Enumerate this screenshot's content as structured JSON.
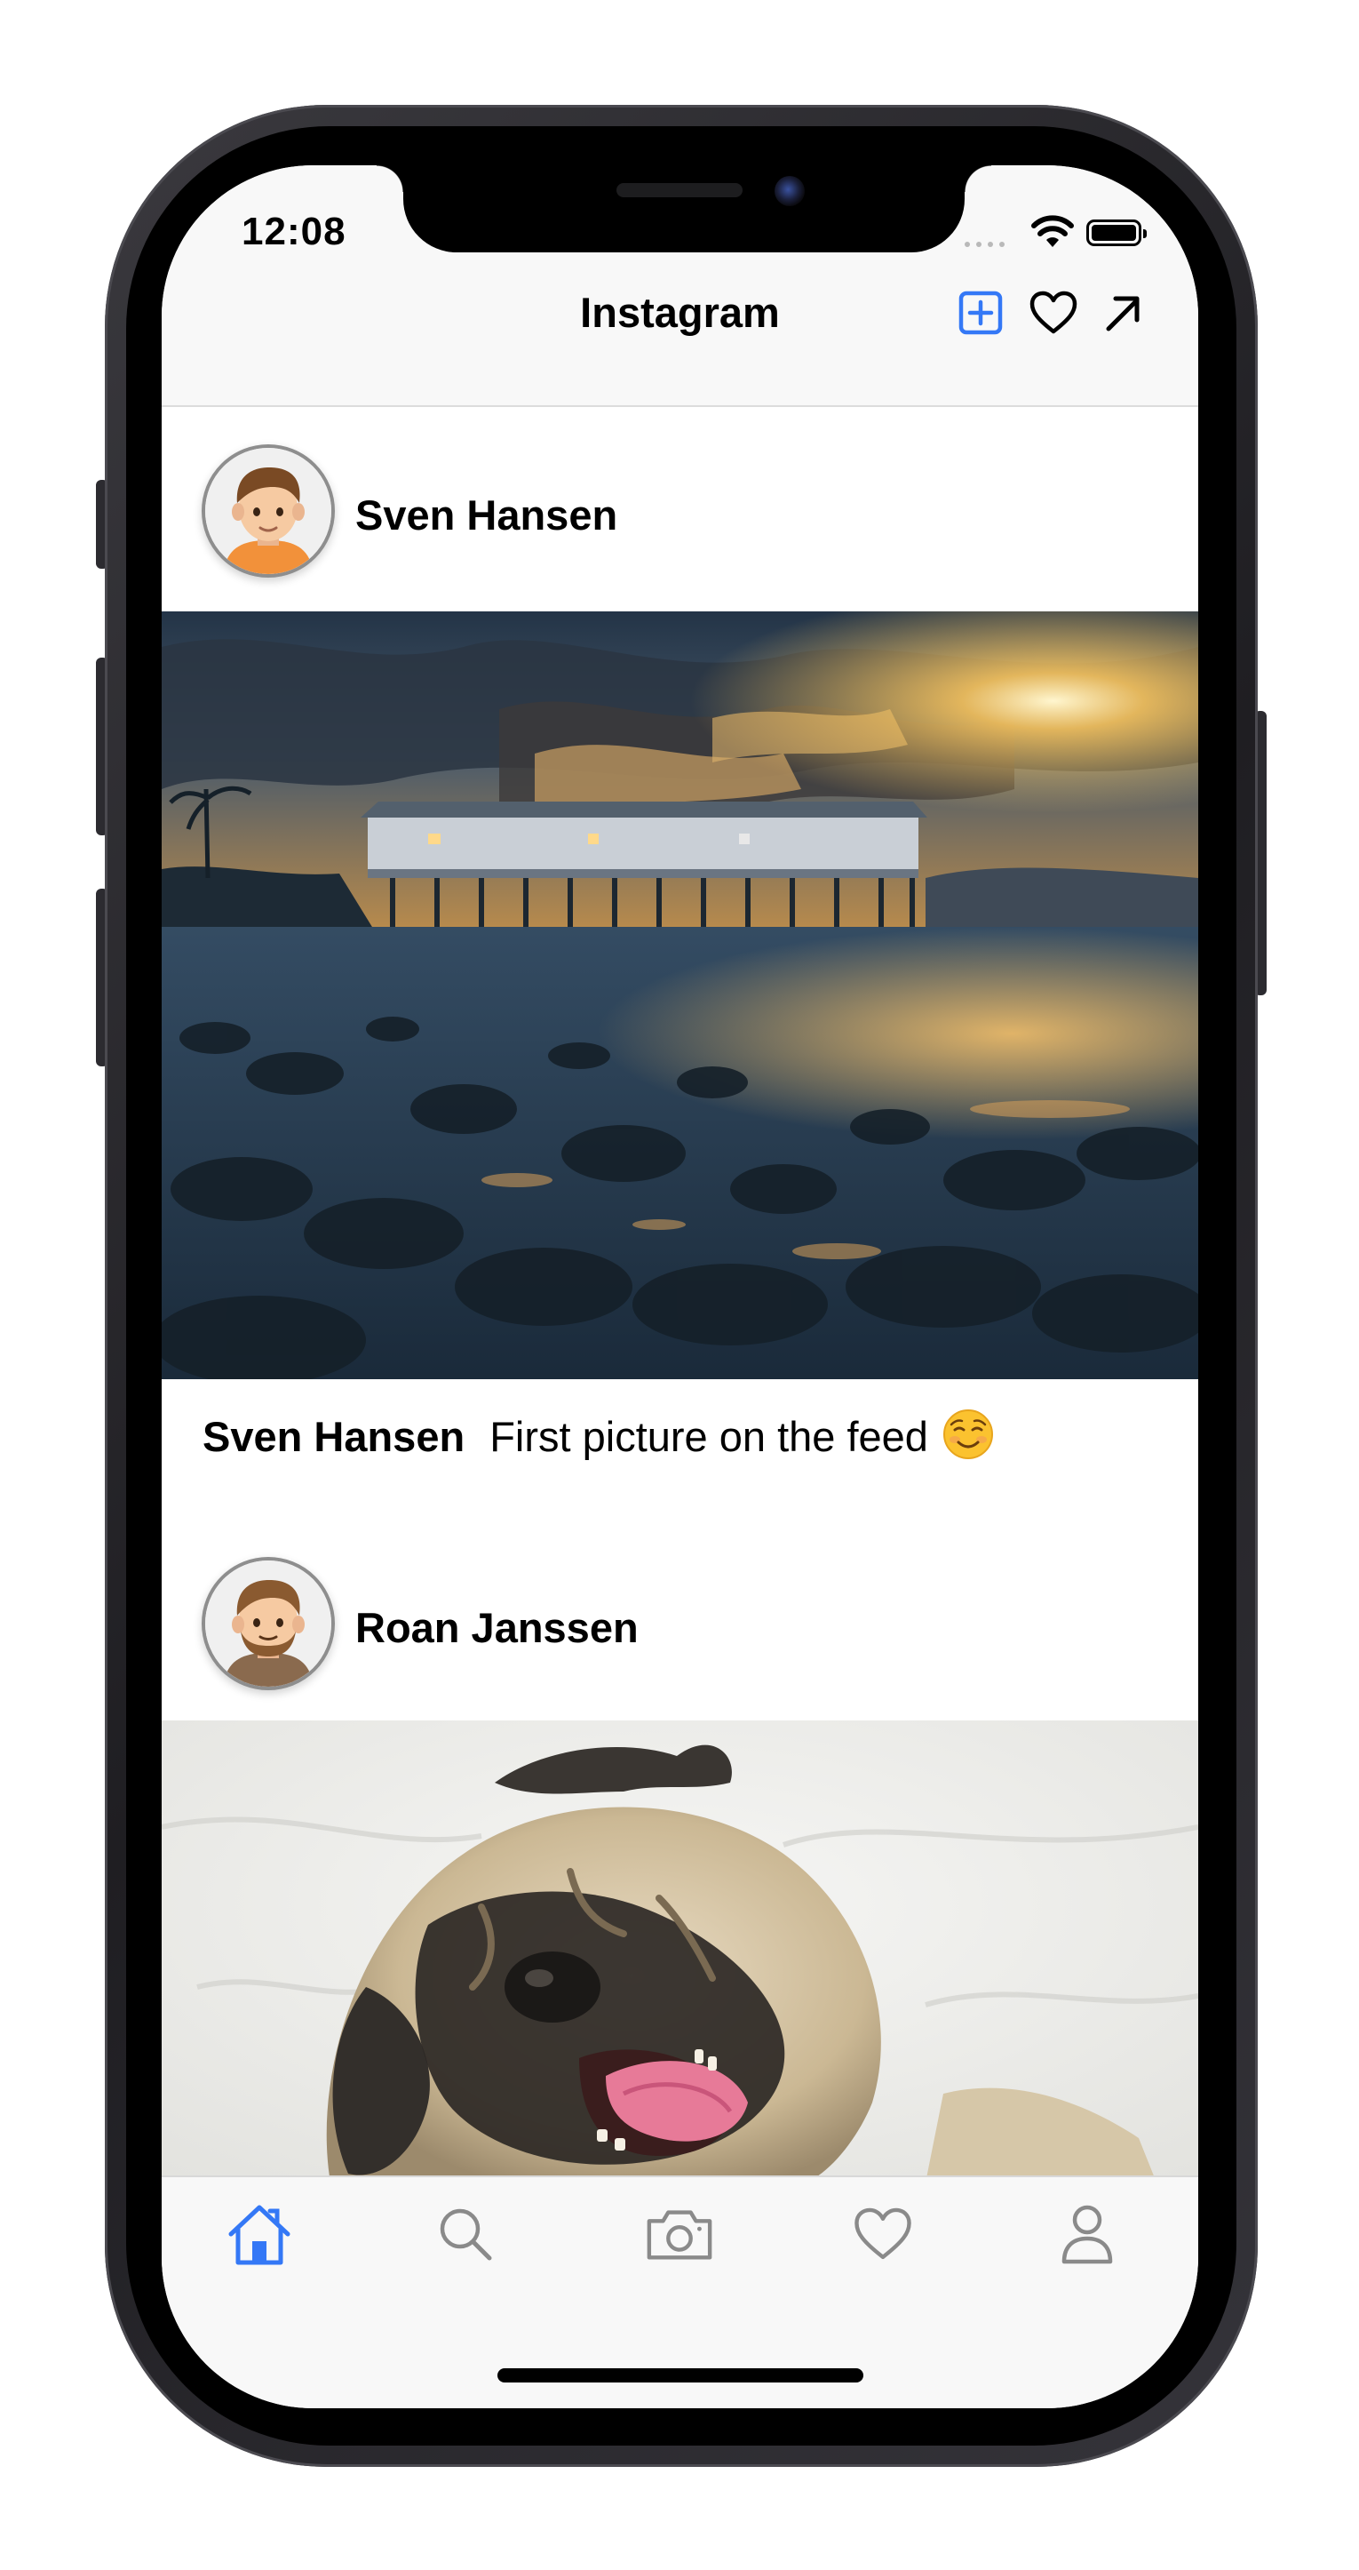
{
  "status_bar": {
    "time": "12:08"
  },
  "navbar": {
    "title": "Instagram",
    "accent": "#3478f6"
  },
  "posts": [
    {
      "username": "Sven Hansen",
      "caption": "First picture on the feed"
    },
    {
      "username": "Roan Janssen"
    }
  ],
  "icons": {
    "nav": [
      "plus-square-icon",
      "heart-icon",
      "arrow-up-right-icon"
    ],
    "tabs": [
      "home-icon",
      "search-icon",
      "camera-icon",
      "heart-icon",
      "person-icon"
    ],
    "caption_emoji": "smiling-face-icon"
  },
  "tabbar": {
    "selected": "home",
    "selected_color": "#3478f6",
    "inactive_color": "#8a8a8a"
  }
}
